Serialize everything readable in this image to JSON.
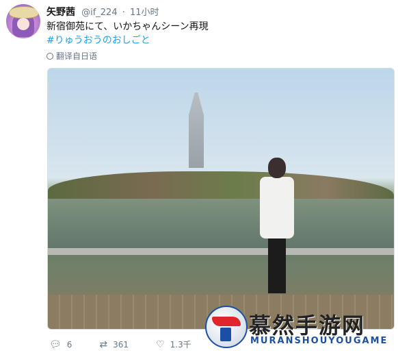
{
  "tweet": {
    "author_name": "矢野茜",
    "handle": "@if_224",
    "separator": "·",
    "time": "11小时",
    "text": "新宿御苑にて、いかちゃんシーン再現",
    "hashtag": "#りゅうおうのおしごと",
    "translate_label": "翻译自日语"
  },
  "actions": {
    "reply_count": "6",
    "retweet_count": "361",
    "like_count": "1.3千"
  },
  "watermark": {
    "cn_text": "慕然手游网",
    "en_text": "MURANSHOUYOUGAME"
  },
  "colors": {
    "hashtag": "#1da1f2",
    "muted": "#657786",
    "text": "#14171a"
  },
  "icons": {
    "reply": "reply-icon",
    "retweet": "retweet-icon",
    "like": "heart-icon",
    "translate": "globe-icon"
  }
}
